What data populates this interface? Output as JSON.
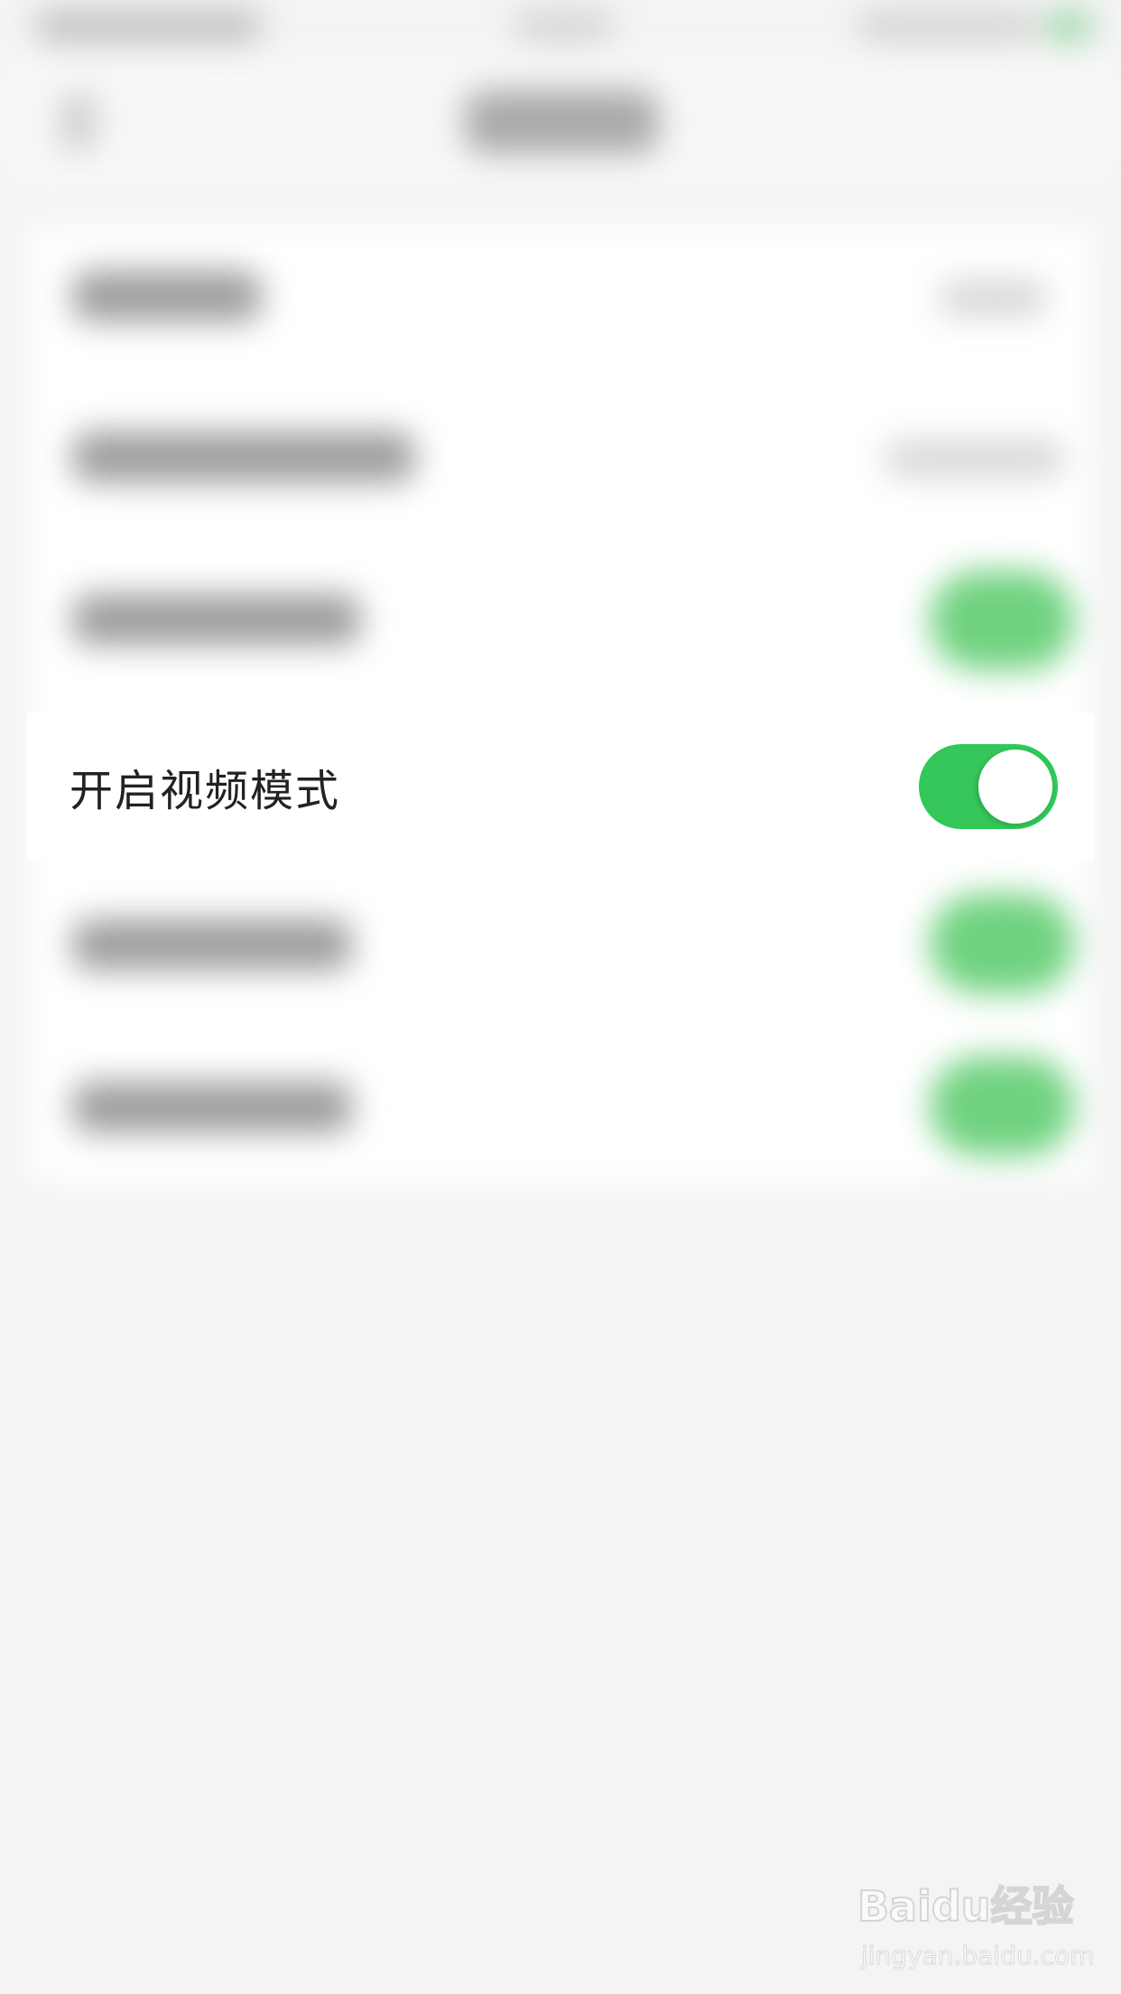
{
  "settings": {
    "focused_row": {
      "label": "开启视频模式",
      "toggle_on": true
    }
  },
  "colors": {
    "toggle_on": "#35C759",
    "page_bg": "#F4F4F4",
    "row_bg": "#FFFFFF",
    "label_text": "#222222"
  },
  "watermark": {
    "logo": "Baidu经验",
    "url": "jingyan.baidu.com"
  }
}
